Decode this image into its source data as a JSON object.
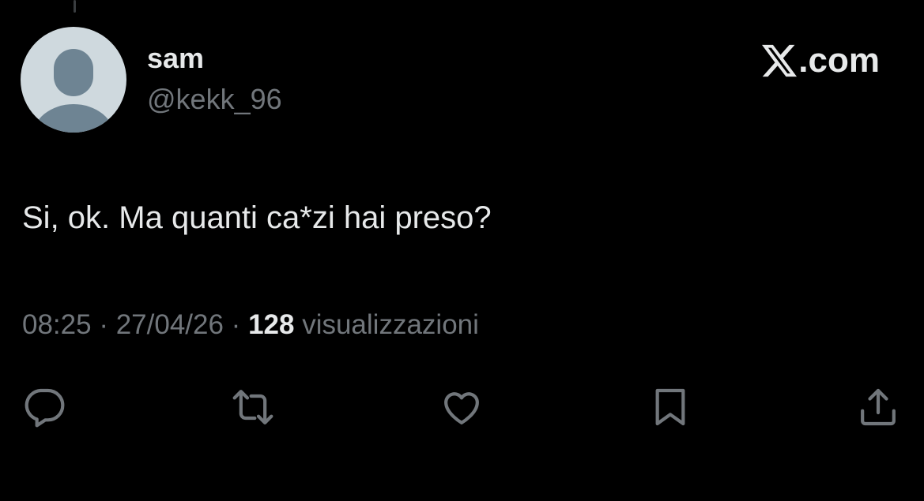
{
  "author": {
    "name": "sam",
    "handle": "@kekk_96"
  },
  "brand": {
    "logo_icon": "x-logo-icon",
    "text": ".com"
  },
  "tweet": {
    "text": "Si, ok. Ma quanti ca*zi hai preso?"
  },
  "meta": {
    "time": "08:25",
    "separator": " · ",
    "date": "27/04/26",
    "views_count": "128",
    "views_label": " visualizzazioni"
  },
  "actions": [
    {
      "name": "reply",
      "icon": "reply-icon"
    },
    {
      "name": "repost",
      "icon": "repost-icon"
    },
    {
      "name": "like",
      "icon": "heart-icon"
    },
    {
      "name": "bookmark",
      "icon": "bookmark-icon"
    },
    {
      "name": "share",
      "icon": "share-icon"
    }
  ],
  "colors": {
    "background": "#000000",
    "primary_text": "#e7e9ea",
    "secondary_text": "#71767b",
    "avatar_bg": "#cfd9de",
    "avatar_silhouette": "#6e8493"
  }
}
